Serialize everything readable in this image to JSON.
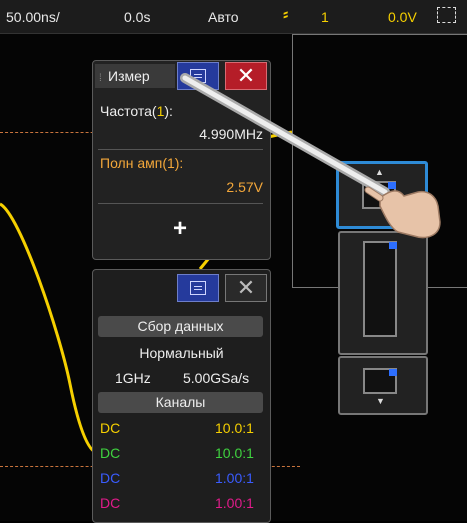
{
  "topbar": {
    "timebase": "50.00ns/",
    "delay": "0.0s",
    "mode": "Авто",
    "trigger_channel": "1",
    "trigger_level": "0.0V"
  },
  "measure_panel": {
    "title": "Измер",
    "close_label": "✕",
    "add_label": "+",
    "freq_prefix": "Частота(",
    "freq_channel": "1",
    "freq_suffix": "):",
    "freq_value": "4.990MHz",
    "amp_label": "Полн амп(1):",
    "amp_value": "2.57V"
  },
  "acq_panel": {
    "close_label": "✕",
    "acq_button": "Сбор данных",
    "mode": "Нормальный",
    "bandwidth": "1GHz",
    "sample_rate": "5.00GSa/s",
    "channels_button": "Каналы",
    "channels": [
      {
        "coupling": "DC",
        "ratio": "10.0:1",
        "color": "#f6d000"
      },
      {
        "coupling": "DC",
        "ratio": "10.0:1",
        "color": "#3fd23f"
      },
      {
        "coupling": "DC",
        "ratio": "1.00:1",
        "color": "#3a5cff"
      },
      {
        "coupling": "DC",
        "ratio": "1.00:1",
        "color": "#e01b8a"
      }
    ]
  },
  "colors": {
    "trace": "#f6d000",
    "accent_blue": "#2e8bd6",
    "marker": "#2d6fff"
  },
  "icons": [
    "trigger-edge-icon",
    "zoom-icon",
    "list-icon",
    "close-icon",
    "plus-icon",
    "up-arrow-icon",
    "down-arrow-icon",
    "hand-pointer-icon"
  ]
}
